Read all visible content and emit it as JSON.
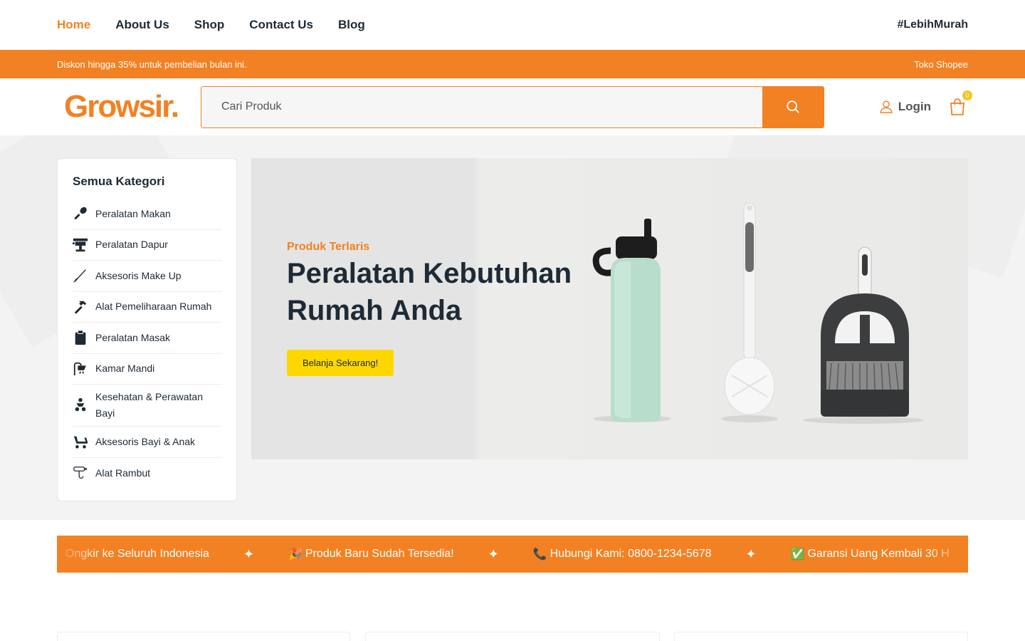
{
  "nav": {
    "links": [
      {
        "label": "Home",
        "active": true
      },
      {
        "label": "About Us",
        "active": false
      },
      {
        "label": "Shop",
        "active": false
      },
      {
        "label": "Contact Us",
        "active": false
      },
      {
        "label": "Blog",
        "active": false
      }
    ],
    "tagline": "#LebihMurah"
  },
  "promo": {
    "text": "Diskon hingga 35% untuk pembelian bulan ini.",
    "store_link": "Toko Shopee"
  },
  "header": {
    "logo": "Growsir.",
    "search_placeholder": "Cari Produk",
    "login_label": "Login",
    "cart_count": "0"
  },
  "sidebar": {
    "title": "Semua Kategori",
    "categories": [
      {
        "label": "Peralatan Makan",
        "icon": "spoon-icon"
      },
      {
        "label": "Peralatan Dapur",
        "icon": "kitchen-icon"
      },
      {
        "label": "Aksesoris Make Up",
        "icon": "brush-icon"
      },
      {
        "label": "Alat Pemeliharaan Rumah",
        "icon": "hammer-icon"
      },
      {
        "label": "Peralatan Masak",
        "icon": "clipboard-icon"
      },
      {
        "label": "Kamar Mandi",
        "icon": "shower-icon"
      },
      {
        "label": "Kesehatan & Perawatan Bayi",
        "icon": "baby-icon"
      },
      {
        "label": "Aksesoris Bayi & Anak",
        "icon": "stroller-icon"
      },
      {
        "label": "Alat Rambut",
        "icon": "hairdryer-icon"
      }
    ]
  },
  "banner": {
    "kicker": "Produk Terlaris",
    "title": "Peralatan Kebutuhan Rumah Anda",
    "cta": "Belanja Sekarang!"
  },
  "ticker": {
    "items": [
      {
        "emoji": "",
        "text": "Ongkir ke Seluruh Indonesia"
      },
      {
        "emoji": "🎉",
        "text": "Produk Baru Sudah Tersedia!"
      },
      {
        "emoji": "📞",
        "text": "Hubungi Kami: 0800-1234-5678"
      },
      {
        "emoji": "✅",
        "text": "Garansi Uang Kembali 30 H"
      }
    ],
    "separator": "✦"
  },
  "colors": {
    "accent": "#f28123",
    "cta": "#fed700",
    "text": "#1e2a35"
  }
}
